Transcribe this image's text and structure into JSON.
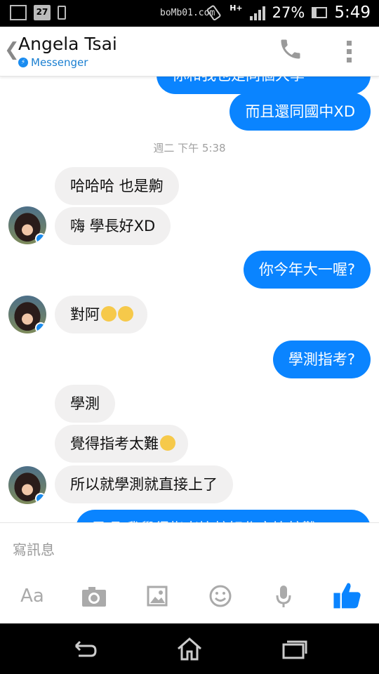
{
  "status_bar": {
    "calendar_day": "27",
    "site_watermark": "boMb01.com",
    "network": "H+",
    "battery": "27%",
    "time": "5:49"
  },
  "header": {
    "back_glyph": "❮",
    "contact_name": "Angela Tsai",
    "app_label": "Messenger"
  },
  "messages": {
    "top_partial": "你和我也是同個大學",
    "m1": "而且還同國中XD",
    "timestamp": "週二 下午 5:38",
    "m2": "哈哈哈 也是齁",
    "m3": "嗨 學長好XD",
    "m4": "你今年大一喔?",
    "m5": "對阿",
    "m6": "學測指考?",
    "m7": "學測",
    "m8": "覺得指考太難",
    "m9": "所以就學測就直接上了",
    "bottom_partial": "是喔 我覺得指考比較好作文比較難"
  },
  "composer": {
    "placeholder": "寫訊息",
    "aa_label": "Aa"
  },
  "colors": {
    "accent": "#0a84ff",
    "incoming": "#f1f0f0",
    "link": "#1a7fd1"
  },
  "icons": [
    "back-icon",
    "phone-icon",
    "more-options-icon",
    "camera-icon",
    "image-icon",
    "emoji-icon",
    "microphone-icon",
    "thumbs-up-icon",
    "nav-back-icon",
    "nav-home-icon",
    "nav-recents-icon"
  ]
}
